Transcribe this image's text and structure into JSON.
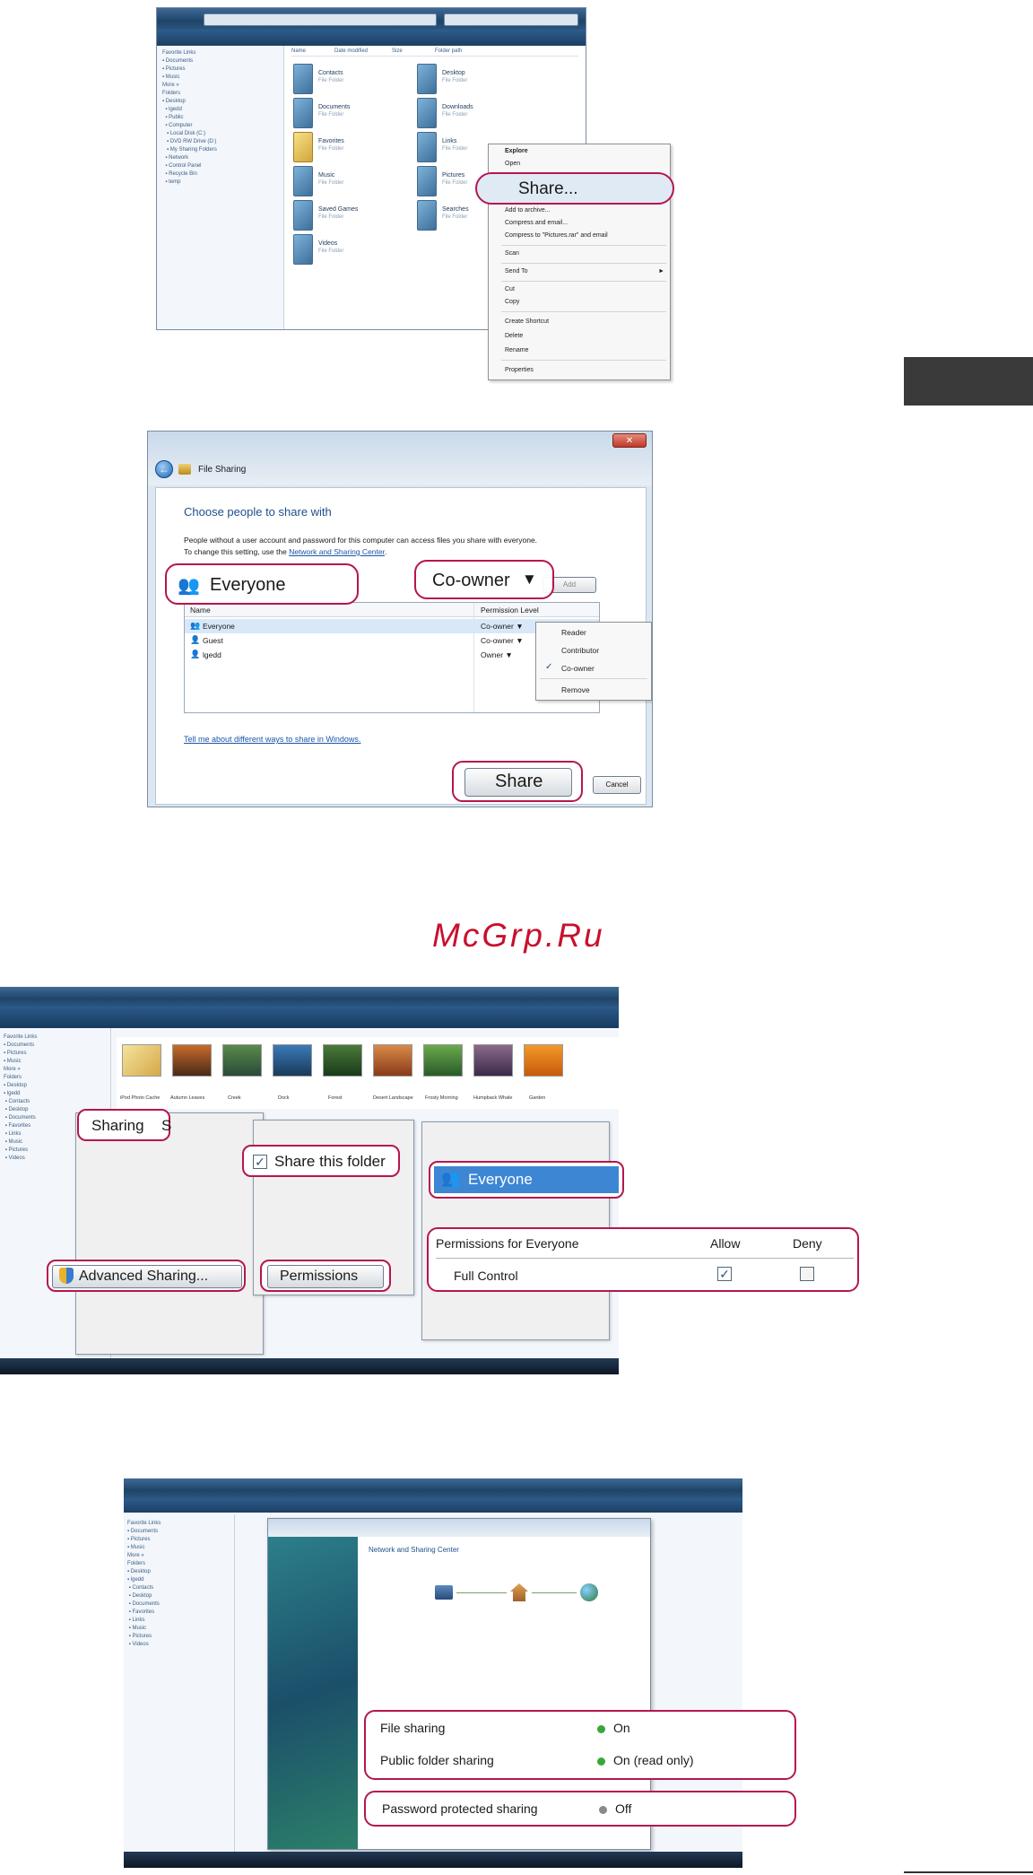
{
  "shot1": {
    "context_menu": {
      "items": [
        "Explore",
        "Open",
        "Share...",
        "Add to archive...",
        "Compress and email...",
        "Compress to \"Pictures.rar\" and email",
        "Scan",
        "Send To",
        "Cut",
        "Copy",
        "Create Shortcut",
        "Delete",
        "Rename",
        "Properties"
      ],
      "highlighted": "Share...",
      "submenu_arrow": "►"
    },
    "columns": [
      "Name",
      "Date modified",
      "Size",
      "Folder path"
    ]
  },
  "shot2": {
    "window_title": "File Sharing",
    "heading": "Choose people to share with",
    "description_line1": "People without a user account and password for this computer can access files you share with everyone.",
    "description_line2_prefix": "To change this setting, use the ",
    "description_link": "Network and Sharing Center",
    "description_line2_suffix": ".",
    "user_input_value": "Everyone",
    "permission_dropdown": "Co-owner",
    "dropdown_arrow": "▼",
    "add_button": "Add",
    "table_headers": [
      "Name",
      "Permission Level"
    ],
    "rows": [
      {
        "name": "Everyone",
        "level": "Co-owner ▼"
      },
      {
        "name": "Guest",
        "level": "Co-owner ▼"
      },
      {
        "name": "lgedd",
        "level": "Owner ▼"
      }
    ],
    "level_menu": [
      "Reader",
      "Contributor",
      "Co-owner",
      "Remove"
    ],
    "level_menu_checked": "Co-owner",
    "check_mark": "✓",
    "help_link": "Tell me about different ways to share in Windows.",
    "share_button": "Share",
    "cancel_button": "Cancel",
    "close_button": "✕"
  },
  "watermark": "McGrp.Ru",
  "shot3": {
    "sharing_tab": "Sharing",
    "sharing_tab_next": "S",
    "share_this_folder": "Share this folder",
    "everyone": "Everyone",
    "permissions_for": "Permissions for Everyone",
    "allow_label": "Allow",
    "deny_label": "Deny",
    "full_control": "Full Control",
    "full_control_allow": true,
    "full_control_deny": false,
    "advanced_sharing_button": "Advanced Sharing...",
    "permissions_button": "Permissions",
    "check_mark": "✓",
    "folder_names": [
      "iPod Photo Cache",
      "Autumn Leaves",
      "Creek",
      "Dock",
      "Forest",
      "Desert Landscape",
      "Frosty Morning",
      "Humpback Whale",
      "Garden"
    ]
  },
  "shot4": {
    "file_sharing": {
      "label": "File sharing",
      "status": "On"
    },
    "public_folder_sharing": {
      "label": "Public folder sharing",
      "status": "On (read only)"
    },
    "password_protected_sharing": {
      "label": "Password protected sharing",
      "status": "Off"
    },
    "status_on_color": "#3aa63a",
    "status_off_color": "#8a8a8a",
    "window_heading": "Network and Sharing Center"
  },
  "colors": {
    "callout_border": "#b5164f",
    "vista_blue": "#1f4468",
    "side_tab": "#3a3a3a"
  }
}
